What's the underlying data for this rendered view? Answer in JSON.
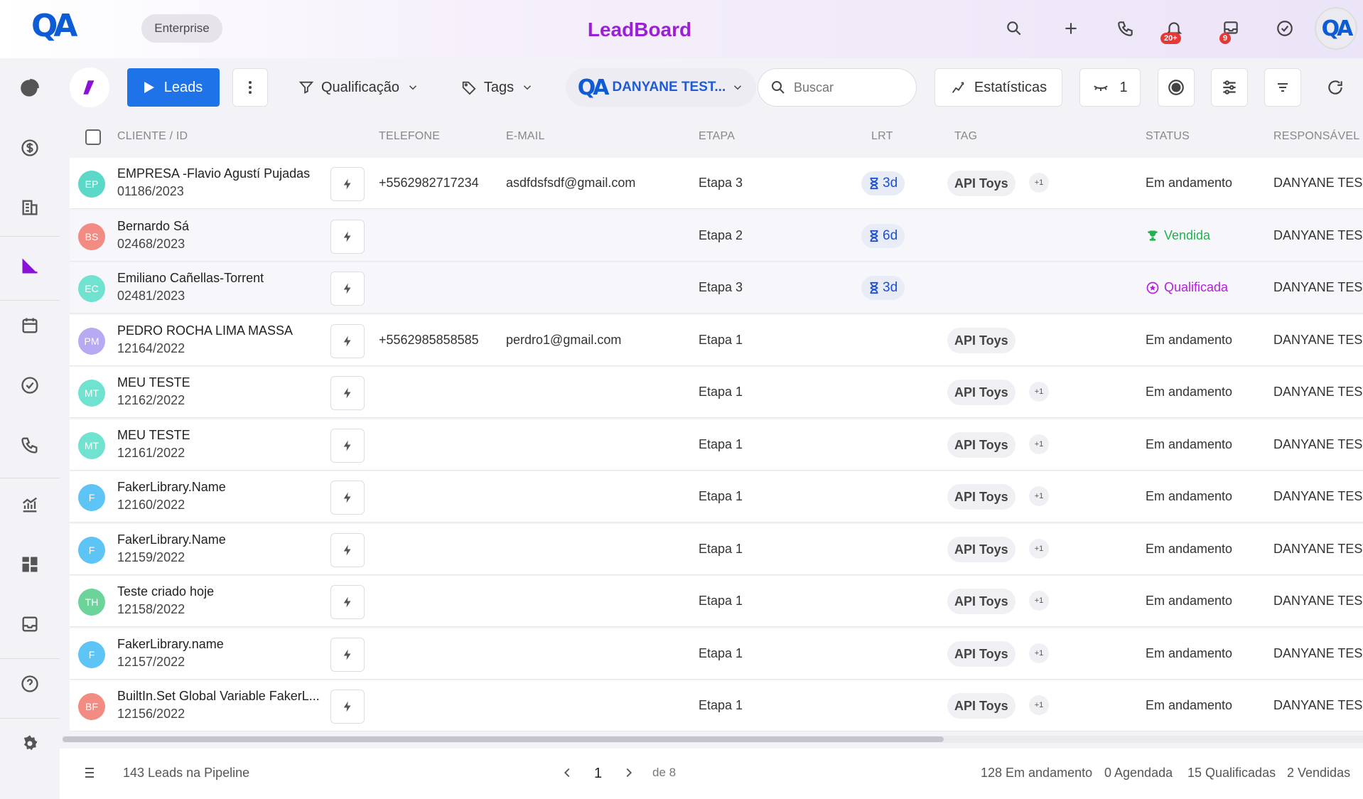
{
  "header": {
    "logo": "QA",
    "plan": "Enterprise",
    "title": "LeadBoard",
    "notif_badge": "20+",
    "inbox_badge": "9",
    "avatar": "QA",
    "icons": [
      "search-icon",
      "plus-icon",
      "phone-icon",
      "bell-icon",
      "inbox-icon",
      "check-circle-icon"
    ]
  },
  "sidebar": {
    "items": [
      "pie-chart-icon",
      "dollar-icon",
      "building-icon",
      "pipeline-icon",
      "calendar-icon",
      "check-circle-icon",
      "phone-icon",
      "bar-chart-icon",
      "dashboard-icon",
      "inbox-icon",
      "help-icon",
      "settings-icon"
    ],
    "active": "pipeline-icon"
  },
  "toolbar": {
    "leads_label": "Leads",
    "qualificacao_label": "Qualificação",
    "tags_label": "Tags",
    "user_filter_label": "DANYANE TEST...",
    "search_placeholder": "Buscar",
    "stats_label": "Estatísticas",
    "hidden_count": "1"
  },
  "table": {
    "columns": [
      "CLIENTE / ID",
      "TELEFONE",
      "E-MAIL",
      "ETAPA",
      "LRT",
      "TAG",
      "STATUS",
      "RESPONSÁVEL"
    ],
    "rows": [
      {
        "initials": "EP",
        "color": "#5bd8c8",
        "name": "EMPRESA -Flavio Agustí Pujadas",
        "id": "01186/2023",
        "phone": "+5562982717234",
        "email": "asdfdsfsdf@gmail.com",
        "stage": "Etapa 3",
        "lrt": "3d",
        "tag": "API Toys",
        "tag_extra": "+1",
        "status": "Em andamento",
        "status_type": "normal",
        "owner": "DANYANE TEST"
      },
      {
        "initials": "BS",
        "color": "#f28b82",
        "name": "Bernardo Sá",
        "id": "02468/2023",
        "phone": "",
        "email": "",
        "stage": "Etapa 2",
        "lrt": "6d",
        "tag": "",
        "tag_extra": "",
        "status": "Vendida",
        "status_type": "sold",
        "owner": "DANYANE TEST"
      },
      {
        "initials": "EC",
        "color": "#6fe3cf",
        "name": "Emiliano Cañellas-Torrent",
        "id": "02481/2023",
        "phone": "",
        "email": "",
        "stage": "Etapa 3",
        "lrt": "3d",
        "tag": "",
        "tag_extra": "",
        "status": "Qualificada",
        "status_type": "qualified",
        "owner": "DANYANE TEST"
      },
      {
        "initials": "PM",
        "color": "#b9a8f2",
        "name": "PEDRO ROCHA LIMA MASSA",
        "id": "12164/2022",
        "phone": "+5562985858585",
        "email": "perdro1@gmail.com",
        "stage": "Etapa 1",
        "lrt": "",
        "tag": "API Toys",
        "tag_extra": "",
        "status": "Em andamento",
        "status_type": "normal",
        "owner": "DANYANE TEST"
      },
      {
        "initials": "MT",
        "color": "#6fe3cf",
        "name": "MEU TESTE",
        "id": "12162/2022",
        "phone": "",
        "email": "",
        "stage": "Etapa 1",
        "lrt": "",
        "tag": "API Toys",
        "tag_extra": "+1",
        "status": "Em andamento",
        "status_type": "normal",
        "owner": "DANYANE TEST"
      },
      {
        "initials": "MT",
        "color": "#6fe3cf",
        "name": "MEU TESTE",
        "id": "12161/2022",
        "phone": "",
        "email": "",
        "stage": "Etapa 1",
        "lrt": "",
        "tag": "API Toys",
        "tag_extra": "+1",
        "status": "Em andamento",
        "status_type": "normal",
        "owner": "DANYANE TEST"
      },
      {
        "initials": "F",
        "color": "#5ec4f5",
        "name": "FakerLibrary.Name",
        "id": "12160/2022",
        "phone": "",
        "email": "",
        "stage": "Etapa 1",
        "lrt": "",
        "tag": "API Toys",
        "tag_extra": "+1",
        "status": "Em andamento",
        "status_type": "normal",
        "owner": "DANYANE TEST"
      },
      {
        "initials": "F",
        "color": "#5ec4f5",
        "name": "FakerLibrary.Name",
        "id": "12159/2022",
        "phone": "",
        "email": "",
        "stage": "Etapa 1",
        "lrt": "",
        "tag": "API Toys",
        "tag_extra": "+1",
        "status": "Em andamento",
        "status_type": "normal",
        "owner": "DANYANE TEST"
      },
      {
        "initials": "TH",
        "color": "#6cd39a",
        "name": "Teste criado hoje",
        "id": "12158/2022",
        "phone": "",
        "email": "",
        "stage": "Etapa 1",
        "lrt": "",
        "tag": "API Toys",
        "tag_extra": "+1",
        "status": "Em andamento",
        "status_type": "normal",
        "owner": "DANYANE TEST"
      },
      {
        "initials": "F",
        "color": "#5ec4f5",
        "name": "FakerLibrary.name",
        "id": "12157/2022",
        "phone": "",
        "email": "",
        "stage": "Etapa 1",
        "lrt": "",
        "tag": "API Toys",
        "tag_extra": "+1",
        "status": "Em andamento",
        "status_type": "normal",
        "owner": "DANYANE TEST"
      },
      {
        "initials": "BF",
        "color": "#f28b82",
        "name": "BuiltIn.Set Global Variable FakerL...",
        "id": "12156/2022",
        "phone": "",
        "email": "",
        "stage": "Etapa 1",
        "lrt": "",
        "tag": "API Toys",
        "tag_extra": "+1",
        "status": "Em andamento",
        "status_type": "normal",
        "owner": "DANYANE TEST"
      }
    ]
  },
  "footer": {
    "total_text": "143 Leads na Pipeline",
    "page": "1",
    "of_pages": "de 8",
    "in_progress": "128 Em andamento",
    "scheduled": "0 Agendada",
    "qualified": "15 Qualificadas",
    "sold": "2 Vendidas"
  },
  "colors": {
    "accent": "#1e73e8",
    "brand_purple": "#9b1fd6",
    "sold_green": "#22b14c",
    "qualified_purple": "#b21fe0"
  }
}
